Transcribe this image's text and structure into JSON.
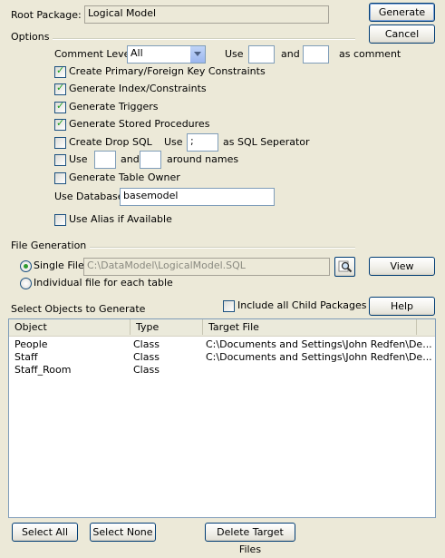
{
  "root_package": {
    "label": "Root Package:",
    "value": "Logical Model"
  },
  "buttons": {
    "generate": "Generate",
    "cancel": "Cancel",
    "view": "View",
    "help": "Help",
    "select_all": "Select All",
    "select_none": "Select None",
    "delete_target_files": "Delete Target Files"
  },
  "options": {
    "group_title": "Options",
    "comment_level_label": "Comment Level",
    "comment_level_value": "All",
    "use_label": "Use",
    "and_label": "and",
    "as_comment_label": "as comment",
    "comment_delim_1": "",
    "comment_delim_2": "",
    "checkboxes": [
      {
        "label": "Create Primary/Foreign Key Constraints",
        "checked": true
      },
      {
        "label": "Generate Index/Constraints",
        "checked": true
      },
      {
        "label": "Generate Triggers",
        "checked": true
      },
      {
        "label": "Generate Stored Procedures",
        "checked": true
      },
      {
        "label": "Create Drop SQL",
        "checked": false
      }
    ],
    "drop_sql_use_label": "Use",
    "sql_separator_value": ";",
    "sql_separator_label": "as SQL Seperator",
    "names_use_label": "Use",
    "names_checked": false,
    "names_and_label": "and",
    "names_delim_1": "",
    "names_delim_2": "",
    "around_names_label": "around names",
    "table_owner_label": "Generate Table Owner",
    "table_owner_checked": false,
    "use_database_label": "Use Database",
    "use_database_value": "basemodel",
    "use_alias_label": "Use Alias if Available",
    "use_alias_checked": false
  },
  "file_generation": {
    "group_title": "File Generation",
    "single_file_label": "Single File",
    "single_file_path": "C:\\DataModel\\LogicalModel.SQL",
    "individual_label": "Individual file for each table",
    "selected": "single"
  },
  "objects": {
    "section_label": "Select Objects to Generate",
    "include_child_label": "Include all Child Packages",
    "include_child_checked": false,
    "columns": [
      "Object",
      "Type",
      "Target File"
    ],
    "rows": [
      {
        "object": "People",
        "type": "Class",
        "target": "C:\\Documents and Settings\\John Redfen\\De..."
      },
      {
        "object": "Staff",
        "type": "Class",
        "target": "C:\\Documents and Settings\\John Redfen\\De..."
      },
      {
        "object": "Staff_Room",
        "type": "Class",
        "target": ""
      }
    ]
  },
  "icons": {
    "browse": "magnifier-icon",
    "dropdown": "chevron-down-icon",
    "check": "checkmark-icon"
  }
}
